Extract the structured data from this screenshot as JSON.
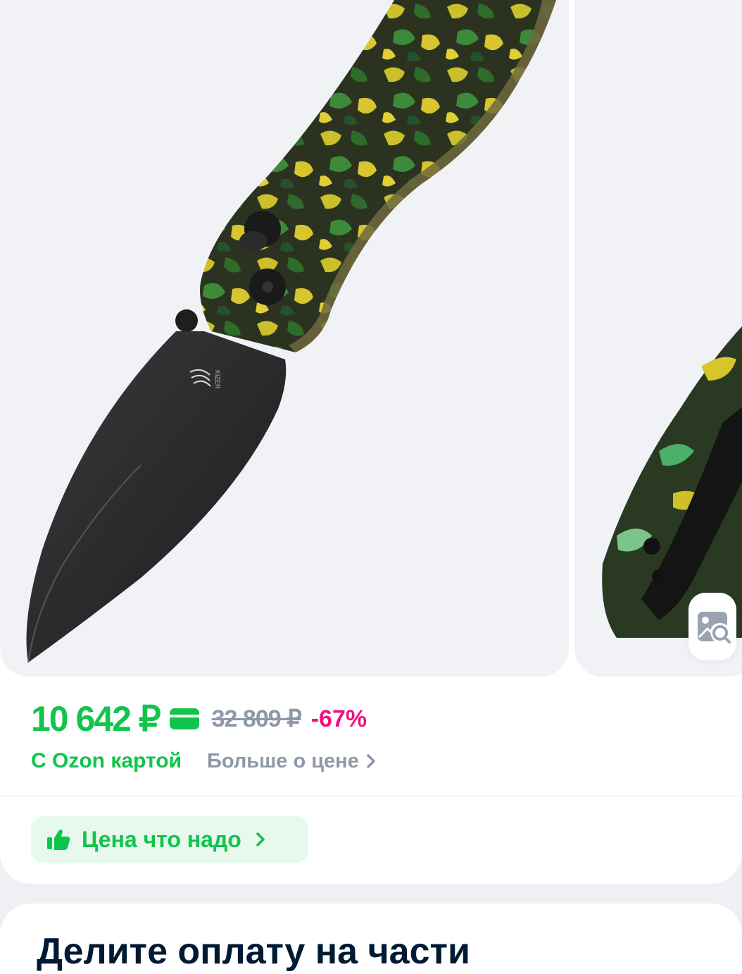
{
  "product": {
    "brand_mark": "KIZER",
    "price": "10 642 ₽",
    "old_price": "32 809 ₽",
    "discount": "-67%",
    "card_label": "С Ozon картой",
    "more_price_label": "Больше о цене",
    "good_price_label": "Цена что надо"
  },
  "installments": {
    "title": "Делите оплату на части"
  },
  "icons": {
    "card": "bank-card-icon",
    "chevron": "chevron-right-icon",
    "thumb": "thumbs-up-icon",
    "visual_search": "visual-search-icon"
  },
  "colors": {
    "green": "#10c44c",
    "pink": "#f1117e",
    "gray": "#8f98a6",
    "dark": "#001a34",
    "green_bg": "#e6f9ec"
  }
}
